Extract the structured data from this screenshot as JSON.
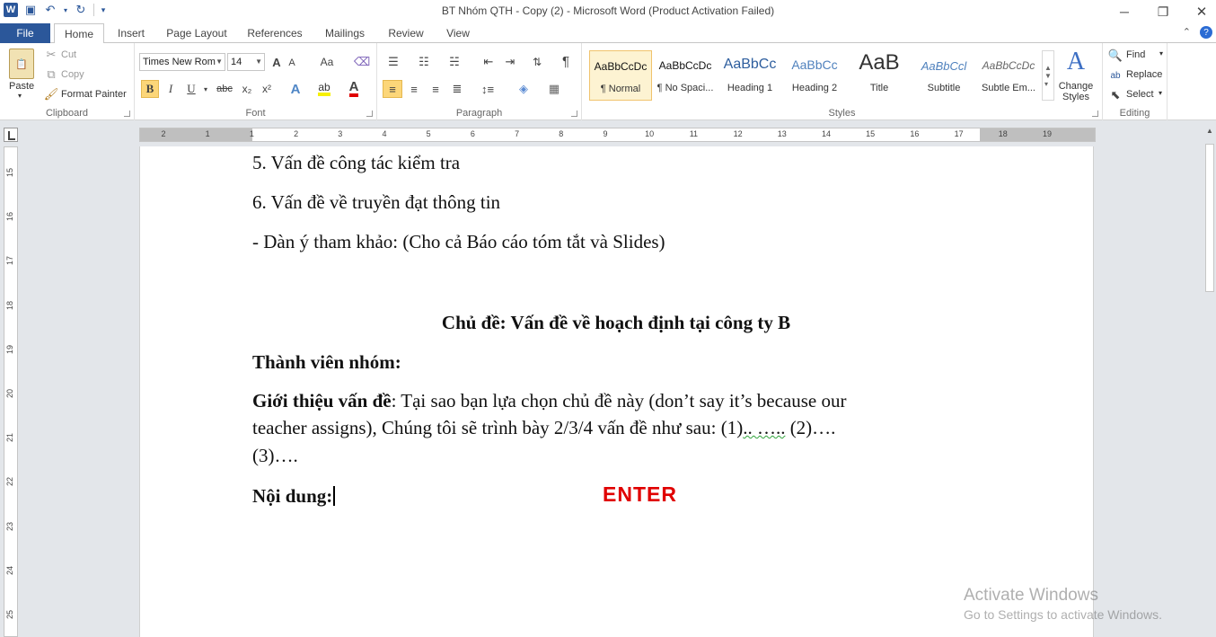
{
  "window": {
    "title": "BT Nhóm QTH - Copy (2)  -  Microsoft Word (Product Activation Failed)",
    "minimize": "─",
    "restore": "❐",
    "close": "✕"
  },
  "qat": {
    "logo": "W",
    "save_icon": "save-icon",
    "undo_icon": "undo-icon",
    "redo_icon": "redo-icon"
  },
  "tabs": [
    "File",
    "Home",
    "Insert",
    "Page Layout",
    "References",
    "Mailings",
    "Review",
    "View"
  ],
  "ribbon": {
    "clipboard": {
      "label": "Clipboard",
      "paste": "Paste",
      "cut": "Cut",
      "copy": "Copy",
      "format_painter": "Format Painter"
    },
    "font": {
      "label": "Font",
      "font_name": "Times New Rom",
      "font_size": "14",
      "bold": "B",
      "italic": "I",
      "underline": "U",
      "strike": "abc",
      "subscript": "x₂",
      "superscript": "x²",
      "grow": "A",
      "shrink": "A",
      "case": "Aa",
      "font_color": "A"
    },
    "paragraph": {
      "label": "Paragraph",
      "pilcrow": "¶"
    },
    "styles": {
      "label": "Styles",
      "items": [
        {
          "sample": "AaBbCcDc",
          "name": "¶ Normal"
        },
        {
          "sample": "AaBbCcDc",
          "name": "¶ No Spaci..."
        },
        {
          "sample": "AaBbCc",
          "name": "Heading 1"
        },
        {
          "sample": "AaBbCc",
          "name": "Heading 2"
        },
        {
          "sample": "AaB",
          "name": "Title"
        },
        {
          "sample": "AaBbCcl",
          "name": "Subtitle"
        },
        {
          "sample": "AaBbCcDc",
          "name": "Subtle Em..."
        }
      ],
      "change_styles": "Change Styles"
    },
    "editing": {
      "label": "Editing",
      "find": "Find",
      "replace": "Replace",
      "select": "Select"
    }
  },
  "ruler": {
    "h_ticks": [
      "2",
      "1",
      "1",
      "2",
      "3",
      "4",
      "5",
      "6",
      "7",
      "8",
      "9",
      "10",
      "11",
      "12",
      "13",
      "14",
      "15",
      "16",
      "17",
      "18",
      "19"
    ],
    "v_ticks": [
      "15",
      "16",
      "17",
      "18",
      "19",
      "20",
      "21",
      "22",
      "23",
      "24",
      "25"
    ]
  },
  "document": {
    "line1": "5. Vấn đề công tác kiểm tra",
    "line2": "6. Vấn đề về truyền đạt thông tin",
    "line3": "- Dàn ý tham khảo: (Cho cả Báo cáo tóm tắt và Slides)",
    "heading": "Chủ đề: Vấn đề về hoạch định tại công ty B",
    "members": "Thành viên nhóm:",
    "intro_label": "Giới thiệu vấn đề",
    "intro_text1": ": Tại sao bạn lựa chọn chủ đề này (don’t say it’s because our",
    "intro_text2a": "teacher assigns), Chúng tôi sẽ trình bày 2/3/4 vấn đề như sau: (1)",
    "intro_text2b": ".. …..",
    "intro_text2c": " (2)….",
    "intro_text3": "(3)….",
    "content_label": "Nội dung:"
  },
  "annotation": {
    "enter": "ENTER"
  },
  "watermark": {
    "line1": "Activate Windows",
    "line2": "Go to Settings to activate Windows."
  }
}
